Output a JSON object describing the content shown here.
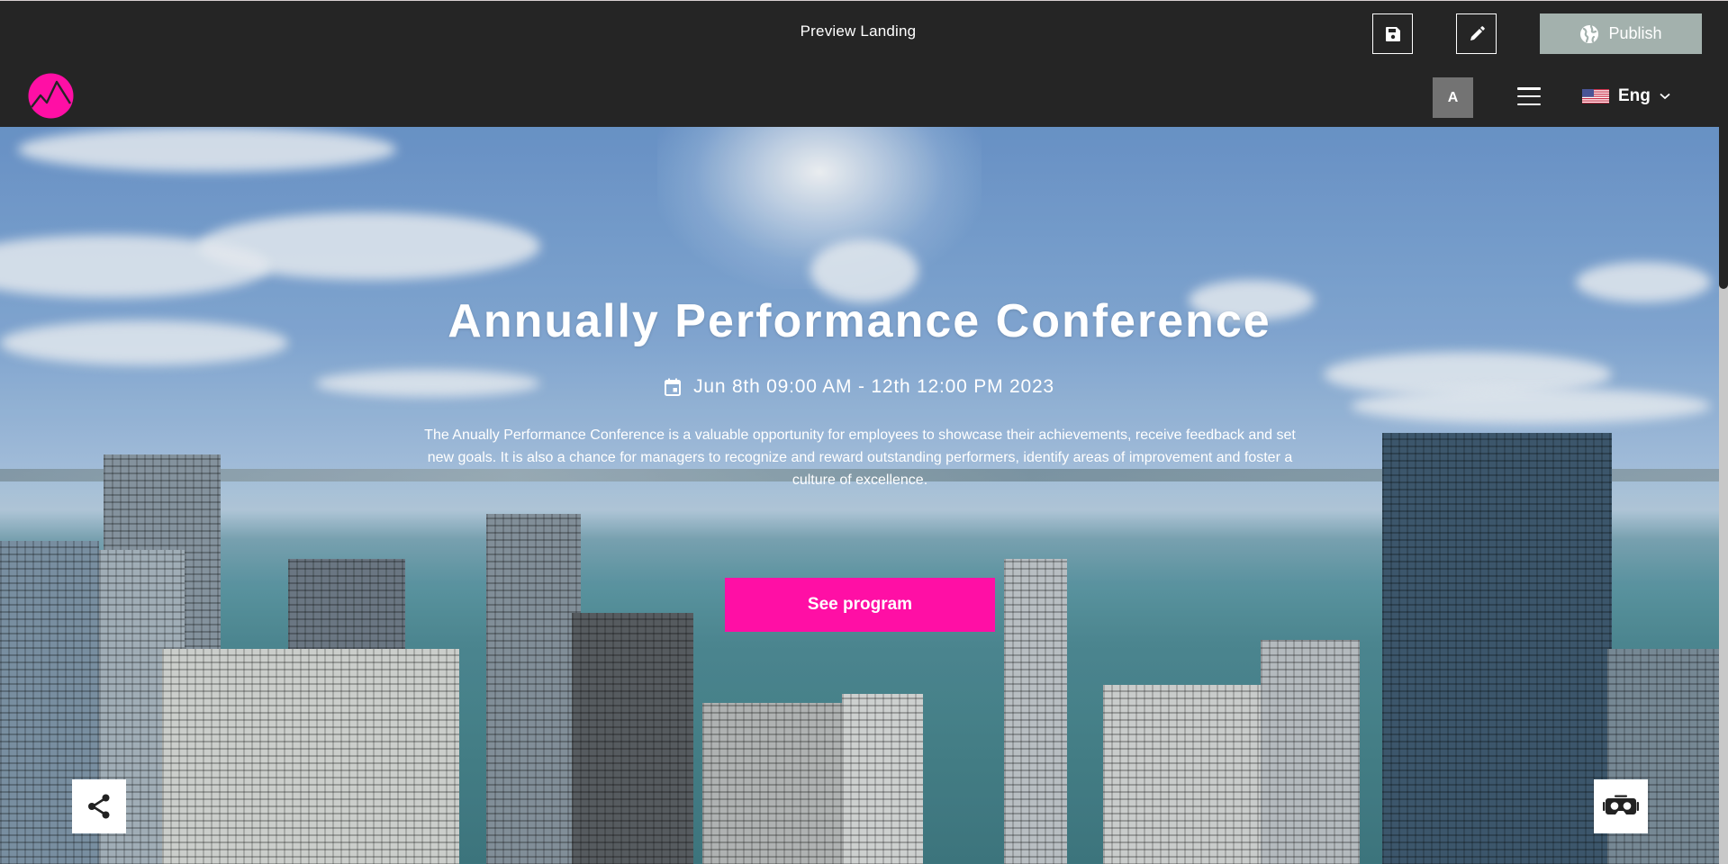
{
  "toolbar": {
    "title": "Preview Landing",
    "save_icon": "floppy-disk-icon",
    "edit_icon": "pencil-icon",
    "publish_label": "Publish",
    "publish_icon": "globe-icon"
  },
  "navbar": {
    "logo_icon": "mountain-logo-icon",
    "avatar_initial": "A",
    "menu_icon": "hamburger-icon",
    "language": {
      "selected": "Eng",
      "flag_icon": "us-flag-icon",
      "chevron_icon": "chevron-down-icon"
    }
  },
  "hero": {
    "title": "Annually Performance Conference",
    "date_icon": "calendar-icon",
    "date": "Jun 8th 09:00 AM - 12th 12:00 PM 2023",
    "description": "The Anually Performance Conference is a valuable opportunity for employees to showcase their achievements, receive feedback and set new goals. It is also a chance for managers to recognize and reward outstanding performers, identify areas of improvement and foster a culture of excellence.",
    "cta_label": "See program",
    "share_icon": "share-icon",
    "vr_icon": "vr-headset-icon"
  },
  "colors": {
    "brand_accent": "#ff0fa5",
    "toolbar_bg": "#252525",
    "publish_bg": "#a3b1ad",
    "avatar_bg": "#737373"
  }
}
